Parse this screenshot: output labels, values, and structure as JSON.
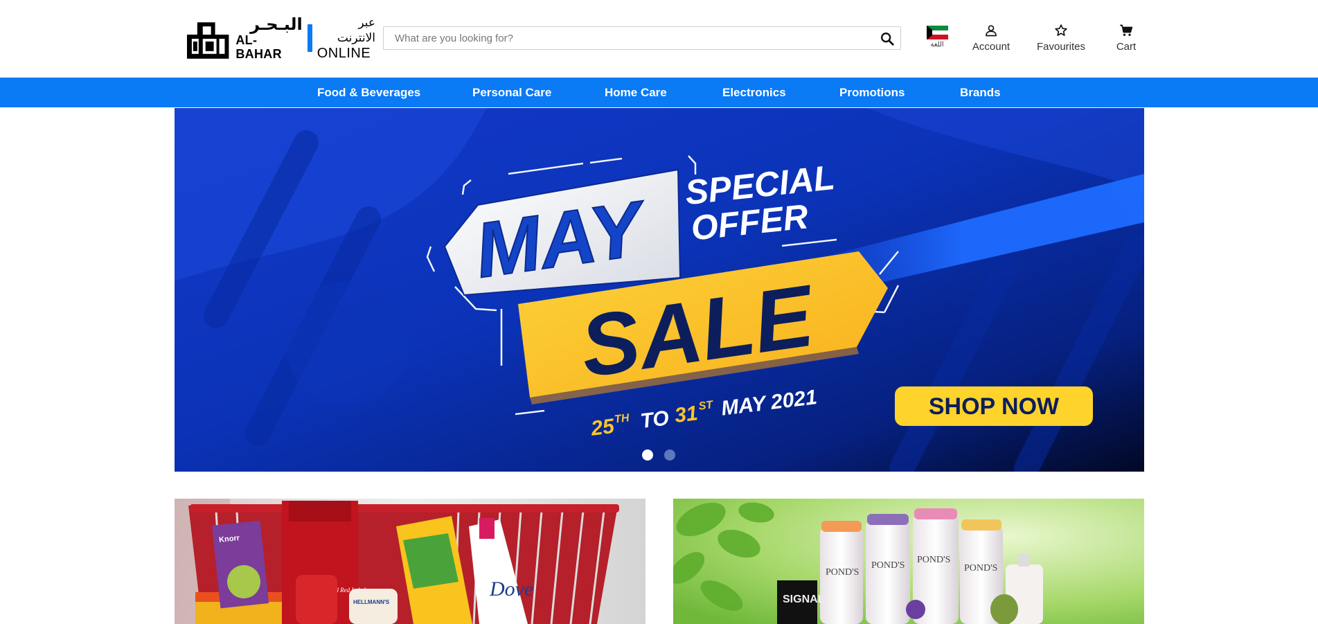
{
  "brand": {
    "logo_arabic": "البـحـر",
    "logo_english": "AL-BAHAR",
    "tagline_arabic": "عبر الانترنت",
    "tagline_english": "ONLINE",
    "accent_color": "#0a7af5"
  },
  "search": {
    "placeholder": "What are you looking for?",
    "value": "",
    "icon": "search-icon"
  },
  "header": {
    "language_label": "اللغة",
    "language_flag": "kuwait-flag-icon",
    "account_label": "Account",
    "favourites_label": "Favourites",
    "cart_label": "Cart"
  },
  "nav": {
    "items": [
      {
        "label": "Food & Beverages"
      },
      {
        "label": "Personal Care"
      },
      {
        "label": "Home Care"
      },
      {
        "label": "Electronics"
      },
      {
        "label": "Promotions"
      },
      {
        "label": "Brands"
      }
    ]
  },
  "hero": {
    "title_1": "MAY",
    "title_2": "SALE",
    "special_1": "SPECIAL",
    "special_2": "OFFER",
    "date_start_num": "25",
    "date_start_sup": "TH",
    "date_to": "TO",
    "date_end_num": "31",
    "date_end_sup": "ST",
    "date_month_year": "MAY 2021",
    "cta": "SHOP NOW",
    "slides_total": 2,
    "active_slide": 1
  },
  "tiles": {
    "left_brands": [
      "Knorr",
      "Brooke Bond Red Label",
      "HELLMANN'S",
      "Dove"
    ],
    "right_brands": [
      "POND'S",
      "POND'S",
      "POND'S",
      "POND'S",
      "SIGNAL"
    ]
  },
  "colors": {
    "nav_bg": "#0a7af5",
    "hero_bg": "#0a2fb0",
    "sale_yellow": "#fcc52b",
    "cta_yellow": "#fdd32c",
    "dark_navy": "#0c1e5c"
  }
}
